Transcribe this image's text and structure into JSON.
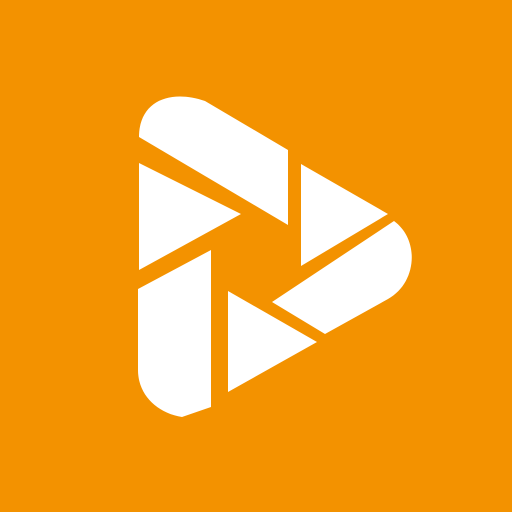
{
  "app_icon": {
    "icon": "video-play-aperture-icon",
    "background_color": "#F39200",
    "foreground_color": "#FFFFFF"
  }
}
